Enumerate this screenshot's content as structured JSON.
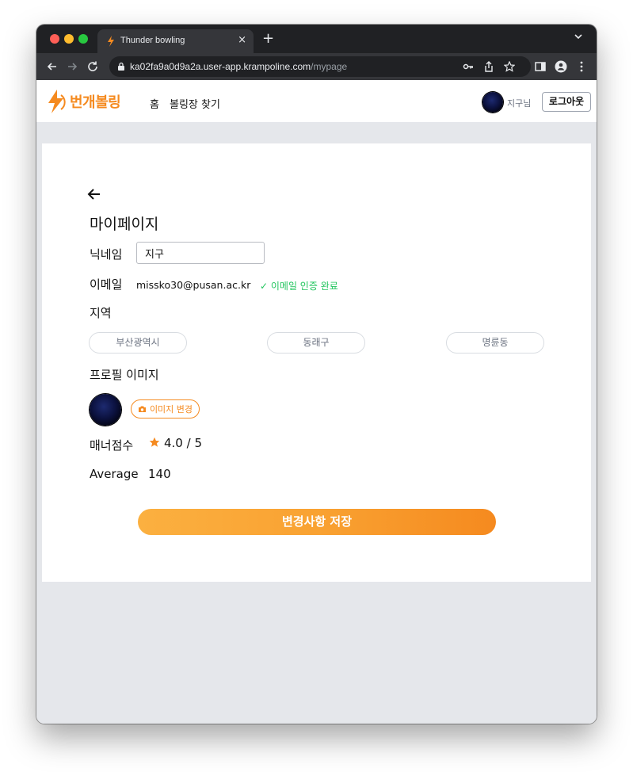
{
  "browser": {
    "tab_title": "Thunder bowling",
    "tab_close": "×",
    "new_tab": "+",
    "url_host": "ka02fa9a0d9a2a.user-app.krampoline.com",
    "url_path": "/mypage"
  },
  "header": {
    "logo_text": "번개볼링",
    "nav": [
      "홈",
      "볼링장 찾기"
    ],
    "user_name": "지구님",
    "logout_label": "로그아웃"
  },
  "mypage": {
    "title": "마이페이지",
    "nickname_label": "닉네임",
    "nickname_value": "지구",
    "email_label": "이메일",
    "email_value": "missko30@pusan.ac.kr",
    "email_verified": "✓ 이메일 인증 완료",
    "region_label": "지역",
    "regions": [
      "부산광역시",
      "동래구",
      "명륜동"
    ],
    "profile_image_label": "프로필 이미지",
    "change_image_label": "이미지 변경",
    "manner_label": "매너점수",
    "manner_score": "4.0 / 5",
    "average_label": "Average",
    "average_value": "140",
    "save_label": "변경사항 저장"
  },
  "colors": {
    "brand": "#f58a1f",
    "verified": "#22c55e",
    "page_bg": "#e5e7eb"
  },
  "icons": [
    "thunder-logo-icon",
    "back-arrow-icon",
    "camera-icon",
    "star-icon",
    "lock-icon",
    "key-icon",
    "share-icon",
    "bookmark-star-icon",
    "side-panel-icon",
    "profile-icon",
    "more-icon"
  ]
}
